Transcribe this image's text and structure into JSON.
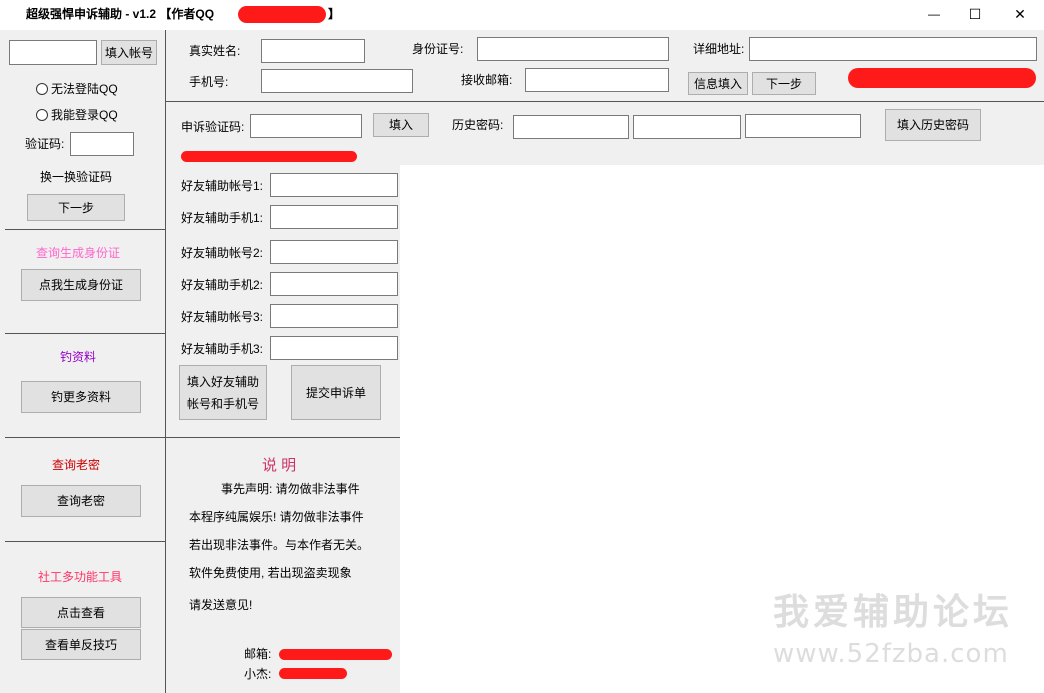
{
  "window": {
    "title": "超级强悍申诉辅助  -  v1.2   【作者QQ",
    "title_suffix": "】",
    "minimize_glyph": "—",
    "maximize_glyph": "☐",
    "close_glyph": "✕"
  },
  "left_panel": {
    "fill_account_button": "填入帐号",
    "radio_cannot_login": "无法登陆QQ",
    "radio_can_login": "我能登录QQ",
    "captcha_label": "验证码:",
    "refresh_captcha": "换一换验证码",
    "next_button": "下一步",
    "section_id": {
      "title": "查询生成身份证",
      "title_color": "#ff66cc",
      "button": "点我生成身份证"
    },
    "section_fish": {
      "title": "钓资料",
      "title_color": "#9900cc",
      "button": "钓更多资料"
    },
    "section_pwd": {
      "title": "查询老密",
      "title_color": "#cc0000",
      "button": "查询老密"
    },
    "section_tools": {
      "title": "社工多功能工具",
      "title_color": "#ff3366",
      "button1": "点击查看",
      "button2": "查看单反技巧"
    }
  },
  "top_form": {
    "real_name_label": "真实姓名:",
    "id_card_label": "身份证号:",
    "address_label": "详细地址:",
    "phone_label": "手机号:",
    "email_label": "接收邮箱:",
    "info_fill_button": "信息填入",
    "next_button": "下一步"
  },
  "appeal_row": {
    "code_label": "申诉验证码:",
    "fill_button": "填入",
    "history_pwd_label": "历史密码:",
    "fill_history_button": "填入历史密码"
  },
  "friends": {
    "fields": [
      {
        "label": "好友辅助帐号1:"
      },
      {
        "label": "好友辅助手机1:"
      },
      {
        "label": "好友辅助帐号2:"
      },
      {
        "label": "好友辅助手机2:"
      },
      {
        "label": "好友辅助帐号3:"
      },
      {
        "label": "好友辅助手机3:"
      }
    ],
    "fill_button_line1": "填入好友辅助",
    "fill_button_line2": "帐号和手机号",
    "submit_button": "提交申诉单"
  },
  "notes": {
    "title": "说  明",
    "title_color": "#cc3366",
    "line1": "事先声明: 请勿做非法事件",
    "line2": "本程序纯属娱乐! 请勿做非法事件",
    "line3": "若出现非法事件。与本作者无关。",
    "line4": "软件免费使用, 若出现盗卖现象",
    "line5": "请发送意见!",
    "email_label": "邮箱:",
    "contact_label": "小杰:"
  },
  "watermark": {
    "line1": "我爱辅助论坛",
    "line2": "www.52fzba.com",
    "color": "#dddddd"
  },
  "colors": {
    "redaction": "#ff1a1a"
  }
}
